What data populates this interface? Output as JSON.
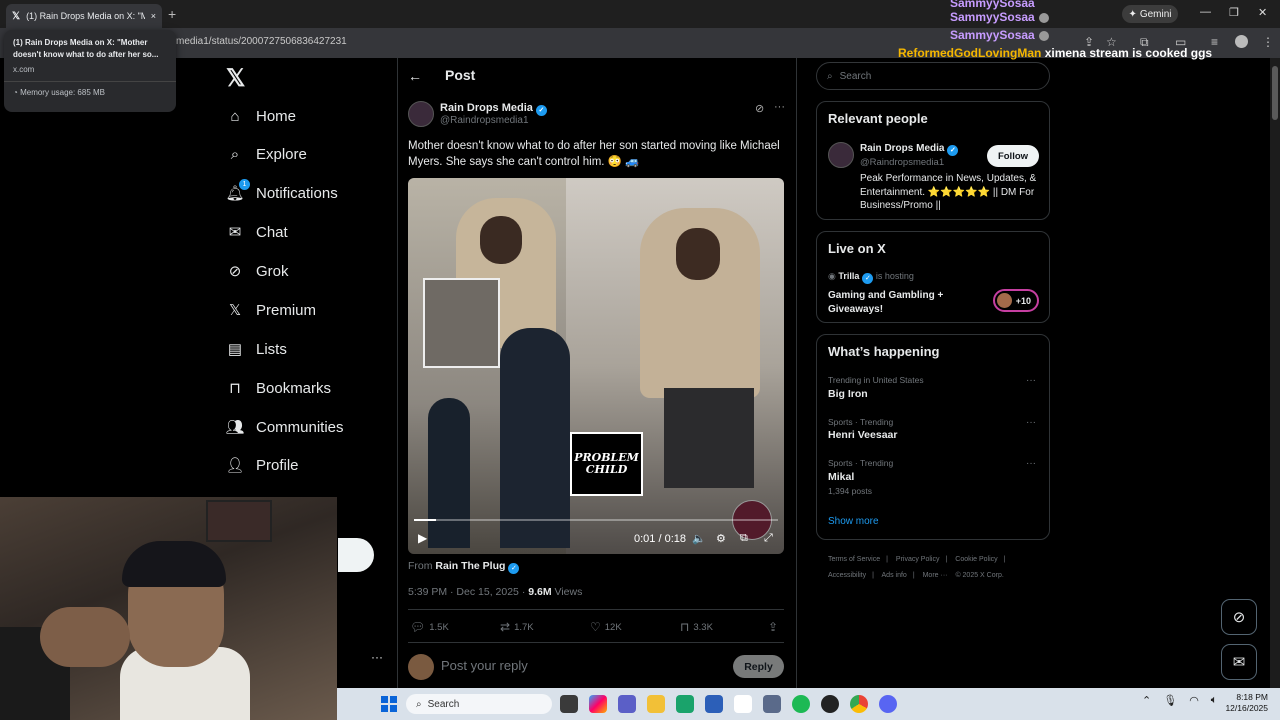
{
  "browser": {
    "tab_title": "(1) Rain Drops Media on X: \"M",
    "tab_close": "×",
    "new_tab": "+",
    "url": "media1/status/2000727506836427231",
    "gemini_label": "Gemini",
    "hovercard": {
      "title": "(1) Rain Drops Media on X: \"Mother doesn't know what to do after her so...",
      "domain": "x.com",
      "memory": "Memory usage: 685 MB"
    }
  },
  "chat_overlay": [
    {
      "name": "SammyySosaa",
      "message": ""
    },
    {
      "name": "SammyySosaa",
      "message": ""
    },
    {
      "name": "ReformedGodLovingMan",
      "message": "ximena stream is cooked ggs"
    }
  ],
  "sidebar": {
    "items": [
      {
        "label": "Home",
        "icon": "home-icon"
      },
      {
        "label": "Explore",
        "icon": "search-icon"
      },
      {
        "label": "Notifications",
        "icon": "bell-icon",
        "badge": "1"
      },
      {
        "label": "Chat",
        "icon": "mail-icon"
      },
      {
        "label": "Grok",
        "icon": "grok-icon"
      },
      {
        "label": "Premium",
        "icon": "x-icon"
      },
      {
        "label": "Lists",
        "icon": "list-icon"
      },
      {
        "label": "Bookmarks",
        "icon": "bookmark-icon"
      },
      {
        "label": "Communities",
        "icon": "people-icon"
      },
      {
        "label": "Profile",
        "icon": "person-icon"
      }
    ]
  },
  "post": {
    "header": "Post",
    "author_name": "Rain Drops Media",
    "author_handle": "@Raindropsmedia1",
    "text": "Mother doesn't know what to do after her son started moving like Michael Myers. She says she can't control him. 😳 🚙",
    "video_overlay_text": "PROBLEM CHILD",
    "video_time": "0:01 / 0:18",
    "video_progress": 0.06,
    "from_prefix": "From",
    "from_name": "Rain The Plug",
    "timestamp": "5:39 PM · Dec 15, 2025 · ",
    "views_count": "9.6M",
    "views_label": "Views",
    "replies": "1.5K",
    "reposts": "1.7K",
    "likes": "12K",
    "bookmarks": "3.3K",
    "reply_placeholder": "Post your reply",
    "reply_button": "Reply"
  },
  "right": {
    "search_placeholder": "Search",
    "relevant_people": {
      "title": "Relevant people",
      "name": "Rain Drops Media",
      "handle": "@Raindropsmedia1",
      "follow": "Follow",
      "bio": "Peak Performance in News, Updates, & Entertainment. ⭐⭐⭐⭐⭐ || DM For Business/Promo ||"
    },
    "live": {
      "title": "Live on X",
      "host": "Trilla",
      "host_suffix": "is hosting",
      "stream_title": "Gaming and Gambling + Giveaways!",
      "listeners": "+10"
    },
    "happening": {
      "title": "What’s happening",
      "trends": [
        {
          "context": "Trending in United States",
          "name": "Big Iron",
          "count": ""
        },
        {
          "context": "Sports · Trending",
          "name": "Henri Veesaar",
          "count": ""
        },
        {
          "context": "Sports · Trending",
          "name": "Mikal",
          "count": "1,394 posts"
        }
      ],
      "show_more": "Show more"
    },
    "footer": [
      "Terms of Service",
      "Privacy Policy",
      "Cookie Policy",
      "Accessibility",
      "Ads info",
      "More ···",
      "© 2025 X Corp."
    ]
  },
  "taskbar": {
    "search": "Search",
    "time": "8:18 PM",
    "date": "12/16/2025"
  },
  "colors": {
    "accent": "#1d9bf0",
    "background": "#000000",
    "chat_name": "#c79cff",
    "chat_highlight": "#f5b700"
  }
}
